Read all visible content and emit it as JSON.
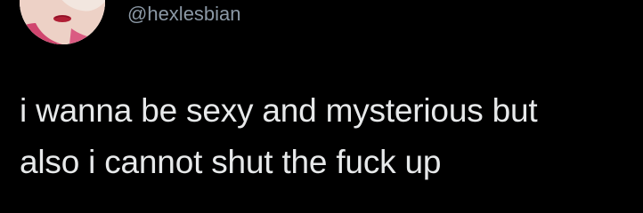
{
  "tweet": {
    "avatar_icon": "profile-avatar",
    "handle": "@hexlesbian",
    "text_lines": [
      "i wanna be sexy and mysterious but",
      "also i cannot shut the fuck up"
    ]
  },
  "colors": {
    "background": "#000000",
    "handle": "#8b98a5",
    "text": "#e7e9ea"
  }
}
